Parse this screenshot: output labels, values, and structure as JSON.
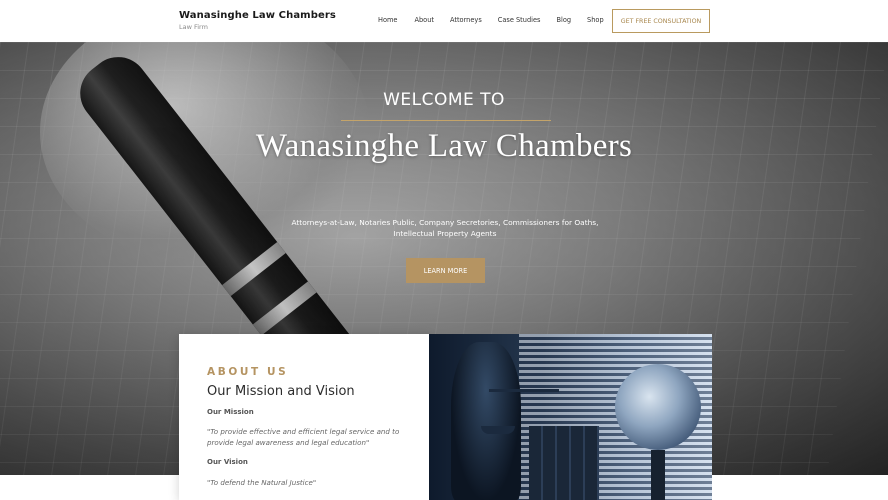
{
  "header": {
    "brand_name": "Wanasinghe Law Chambers",
    "brand_sub": "Law Firm",
    "nav": [
      "Home",
      "About",
      "Attorneys",
      "Case Studies",
      "Blog",
      "Shop"
    ],
    "cta_label": "GET FREE CONSULTATION"
  },
  "hero": {
    "welcome": "WELCOME TO",
    "title": "Wanasinghe Law Chambers",
    "tagline": "Attorneys-at-Law, Notaries Public, Company Secretories, Commissioners for Oaths, Intellectual Property Agents",
    "button_label": "LEARN MORE"
  },
  "about": {
    "eyebrow": "ABOUT US",
    "heading": "Our Mission and Vision",
    "mission_label": "Our Mission",
    "mission_text": "\"To provide effective and efficient legal service and to provide legal awareness and legal education\"",
    "vision_label": "Our Vision",
    "vision_text": "\"To defend the Natural Justice\""
  },
  "colors": {
    "accent": "#b59462",
    "cta_border": "#b99a5f",
    "text_dark": "#2c2c2c"
  },
  "icons": {
    "hero_image": "pen-and-hand-photo",
    "about_image": "lady-justice-photo"
  }
}
